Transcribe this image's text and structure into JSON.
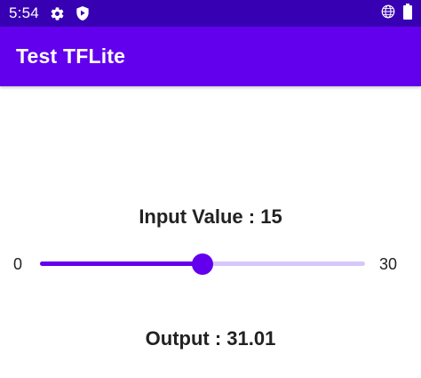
{
  "status_bar": {
    "time": "5:54",
    "left_icons": [
      "settings-icon",
      "shield-icon"
    ],
    "right_icons": [
      "globe-icon",
      "battery-icon"
    ]
  },
  "app_bar": {
    "title": "Test TFLite"
  },
  "input": {
    "label": "Input Value : 15",
    "slider_min": "0",
    "slider_max": "30",
    "slider_value": 15
  },
  "output": {
    "label": "Output : 31.01"
  },
  "colors": {
    "status_bar": "#3700b3",
    "app_bar": "#6200ee",
    "accent": "#6200ee",
    "track_inactive": "#d7c6fb"
  }
}
